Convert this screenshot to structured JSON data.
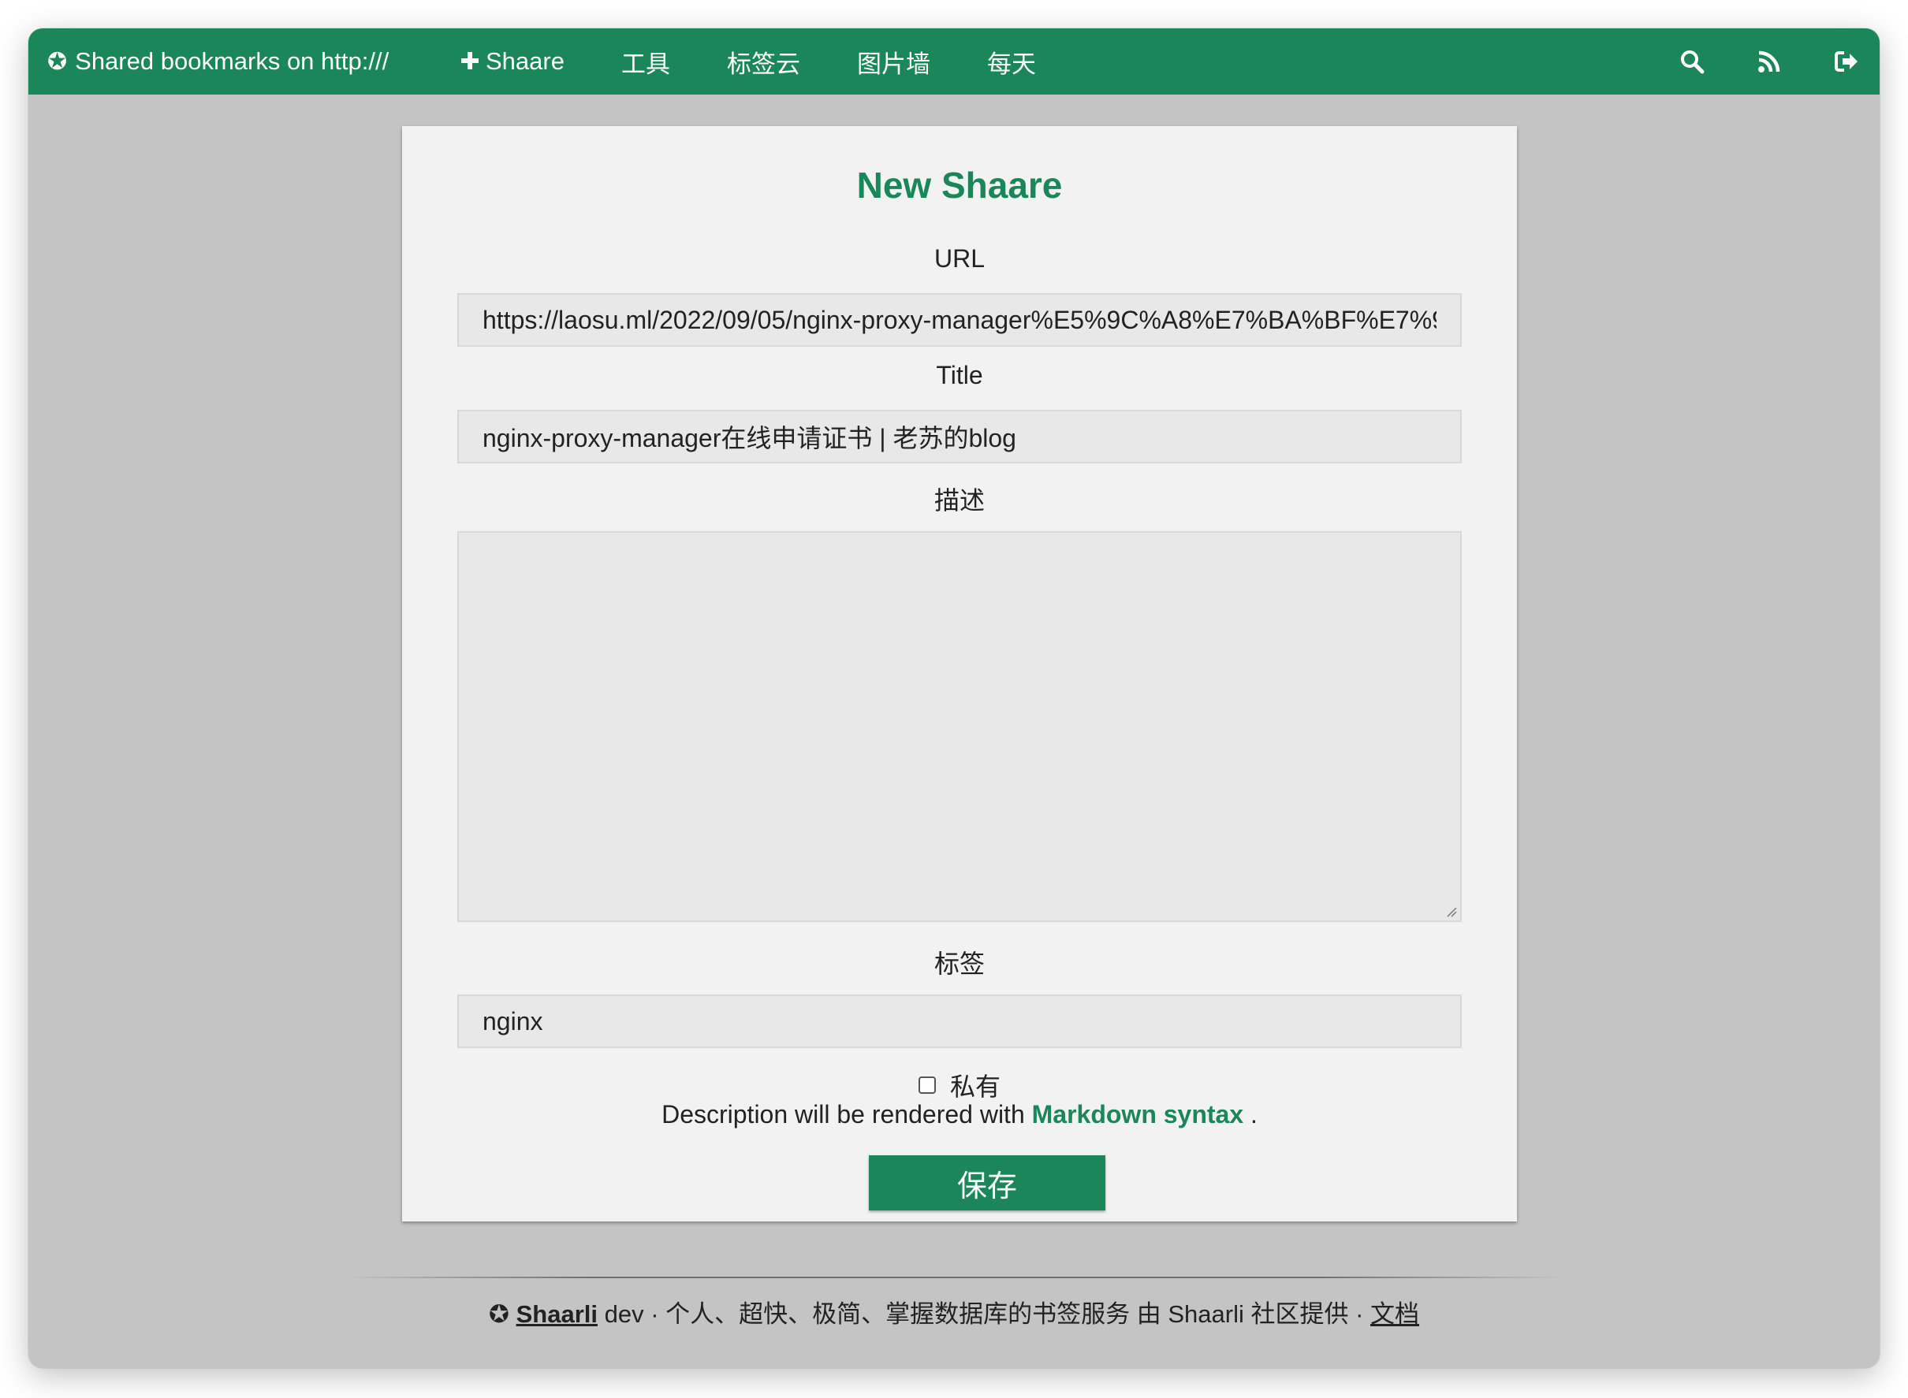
{
  "topbar": {
    "brand_icon": "✪",
    "brand_text": "Shared bookmarks on http:///",
    "nav": [
      {
        "label": "Shaare",
        "icon": "plus-icon"
      },
      {
        "label": "工具"
      },
      {
        "label": "标签云"
      },
      {
        "label": "图片墙"
      },
      {
        "label": "每天"
      }
    ],
    "icons": [
      "search-icon",
      "rss-icon",
      "logout-icon"
    ],
    "color": "#1b865a"
  },
  "form": {
    "heading": "New Shaare",
    "url_label": "URL",
    "url_value": "https://laosu.ml/2022/09/05/nginx-proxy-manager%E5%9C%A8%E7%BA%BF%E7%94%",
    "title_label": "Title",
    "title_value": "nginx-proxy-manager在线申请证书 | 老苏的blog",
    "description_label": "描述",
    "description_value": "",
    "tags_label": "标签",
    "tags_value": "nginx",
    "private_label": "私有",
    "private_checked": false,
    "markdown_prefix": "Description will be rendered with ",
    "markdown_link": "Markdown syntax",
    "markdown_suffix": " .",
    "save_label": "保存"
  },
  "footer": {
    "brand_icon": "✪",
    "brand": "Shaarli",
    "text": " dev · 个人、超快、极简、掌握数据库的书签服务 由 Shaarli 社区提供 · ",
    "docs_link": "文档"
  }
}
